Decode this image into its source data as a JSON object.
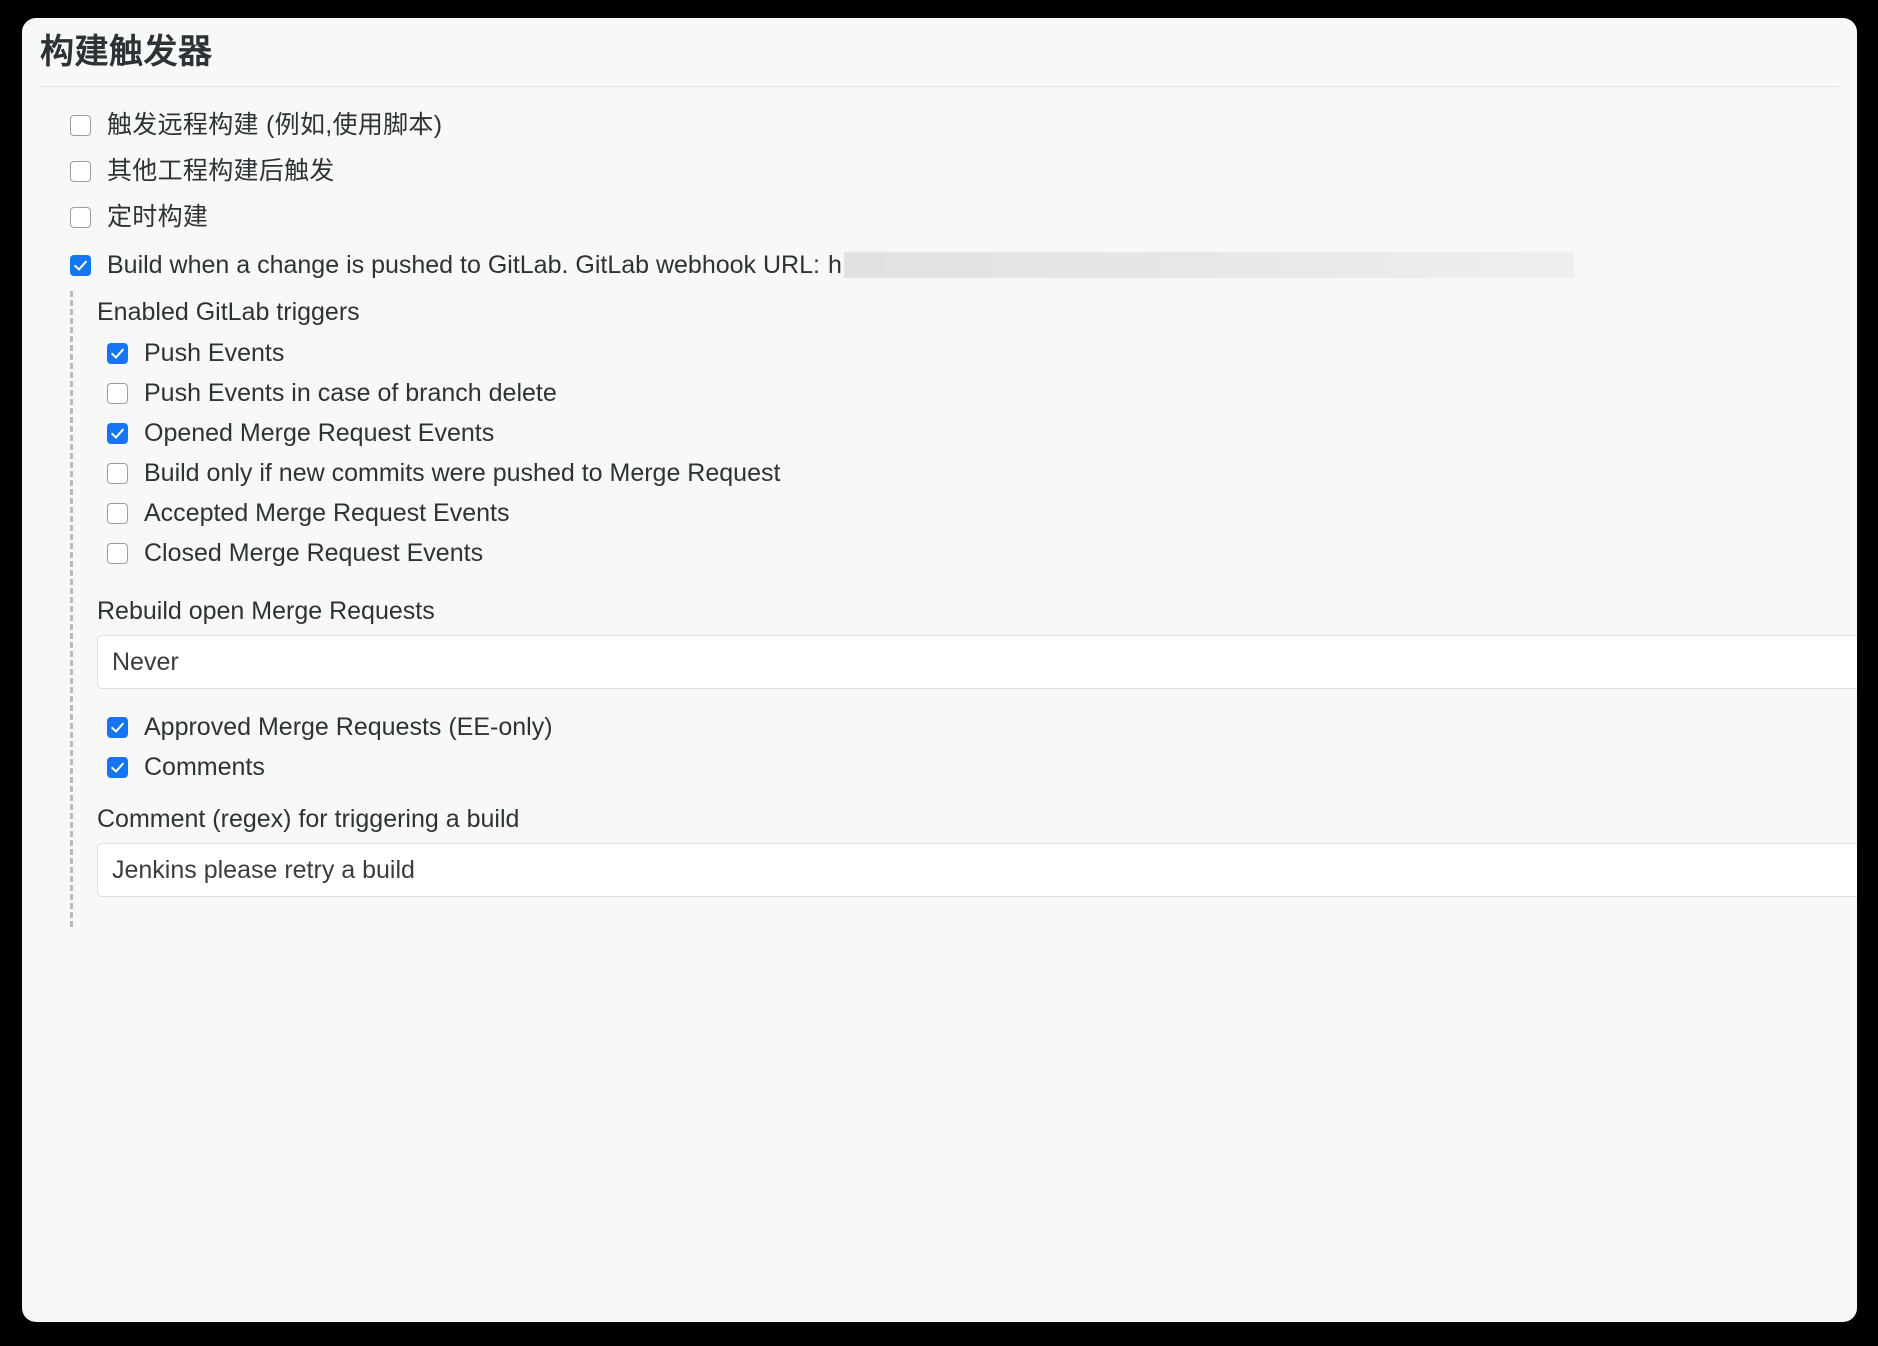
{
  "card": {
    "title": "构建触发器"
  },
  "top_level_triggers": [
    {
      "id": "remote",
      "label": "触发远程构建 (例如,使用脚本)",
      "checked": false,
      "lang": "cjk"
    },
    {
      "id": "upstream",
      "label": "其他工程构建后触发",
      "checked": false,
      "lang": "cjk"
    },
    {
      "id": "schedule",
      "label": "定时构建",
      "checked": false,
      "lang": "cjk"
    }
  ],
  "gitlab_trigger": {
    "label": "Build when a change is pushed to GitLab. GitLab webhook URL:",
    "checked": true,
    "webhook_url_visible_prefix": "h",
    "webhook_url_redacted": true
  },
  "enabled_triggers": {
    "section_label": "Enabled GitLab triggers",
    "items": [
      {
        "id": "push-events",
        "label": "Push Events",
        "checked": true
      },
      {
        "id": "push-events-branch-delete",
        "label": "Push Events in case of branch delete",
        "checked": false
      },
      {
        "id": "opened-mr-events",
        "label": "Opened Merge Request Events",
        "checked": true
      },
      {
        "id": "build-only-new-commits",
        "label": "Build only if new commits were pushed to Merge Request",
        "checked": false
      },
      {
        "id": "accepted-mr-events",
        "label": "Accepted Merge Request Events",
        "checked": false
      },
      {
        "id": "closed-mr-events",
        "label": "Closed Merge Request Events",
        "checked": false
      }
    ]
  },
  "rebuild_open_mr": {
    "label": "Rebuild open Merge Requests",
    "value": "Never"
  },
  "approved_mr": {
    "label": "Approved Merge Requests (EE-only)",
    "checked": true
  },
  "comments_trigger": {
    "label": "Comments",
    "checked": true
  },
  "comment_regex": {
    "label": "Comment (regex) for triggering a build",
    "value": "Jenkins please retry a build"
  },
  "colors": {
    "accent": "#1576f3",
    "card_bg": "#f7f8f8",
    "text": "#2f3234",
    "border": "#dcdee0",
    "dashed_guide": "#b9bbbd",
    "page_bg": "#000000"
  }
}
